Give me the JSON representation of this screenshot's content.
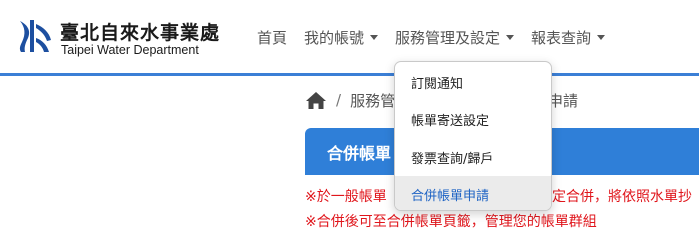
{
  "brand": {
    "name_zh": "臺北自來水事業處",
    "name_en": "Taipei Water Department",
    "logo_color": "#1d4fa0"
  },
  "nav": {
    "items": [
      {
        "label": "首頁",
        "has_caret": false
      },
      {
        "label": "我的帳號",
        "has_caret": true
      },
      {
        "label": "服務管理及設定",
        "has_caret": true
      },
      {
        "label": "報表查詢",
        "has_caret": true
      }
    ]
  },
  "dropdown": {
    "items": [
      {
        "label": "訂閱通知",
        "active": false
      },
      {
        "label": "帳單寄送設定",
        "active": false
      },
      {
        "label": "發票查詢/歸戶",
        "active": false
      },
      {
        "label": "合併帳單申請",
        "active": true
      }
    ]
  },
  "breadcrumb": {
    "home_icon": "home-icon",
    "separator": "/",
    "section": "服務管",
    "current_tail": "申請"
  },
  "panel": {
    "title": "合併帳單",
    "accent_color": "#2f7fd8"
  },
  "notes": {
    "line1_start": "※於一般帳單",
    "line1_end": "定合併，將依照水單抄",
    "line2": "※合併後可至合併帳單頁籤，管理您的帳單群組",
    "color": "#e0161c"
  },
  "colors": {
    "header_border": "#3b7fd6",
    "active_item_text": "#1e63c4"
  }
}
